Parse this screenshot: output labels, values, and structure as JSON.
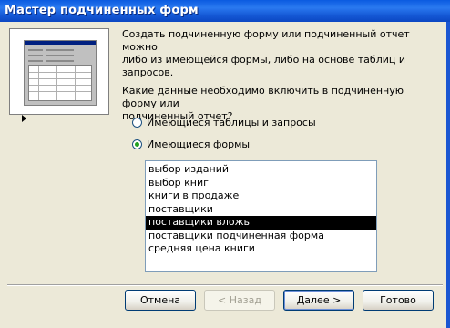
{
  "window": {
    "title": "Мастер подчиненных форм"
  },
  "description": {
    "line1": "Создать подчиненную форму или подчиненный отчет можно",
    "line2": "либо из имеющейся формы, либо на основе таблиц и запросов."
  },
  "question": {
    "line1": "Какие данные необходимо включить в подчиненную форму или",
    "line2": "подчиненный отчет?"
  },
  "options": {
    "tables": {
      "label": "Имеющиеся таблицы и запросы",
      "checked": false
    },
    "forms": {
      "label": "Имеющиеся формы",
      "checked": true
    }
  },
  "forms_list": {
    "items": [
      "выбор изданий",
      "выбор книг",
      "книги в продаже",
      "поставщики",
      "поставщики вложь",
      "поставщики подчиненная форма",
      "средняя цена книги"
    ],
    "selected_index": 4
  },
  "buttons": {
    "cancel": "Отмена",
    "back": "< Назад",
    "next": "Далее >",
    "finish": "Готово"
  }
}
